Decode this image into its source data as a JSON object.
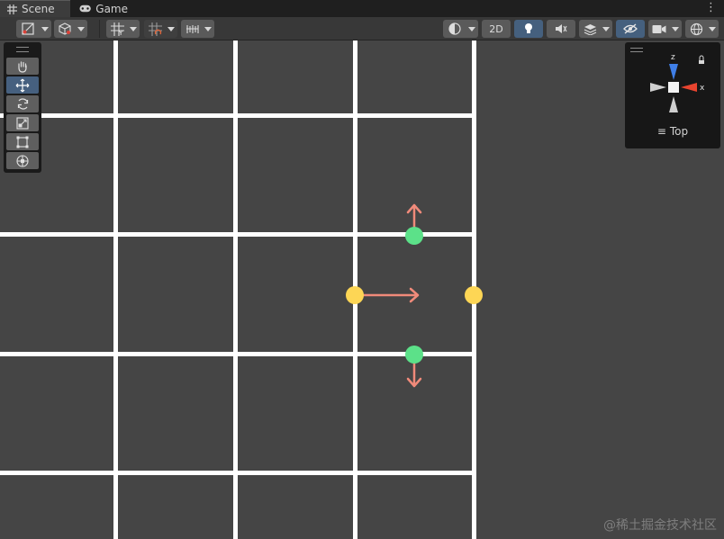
{
  "tabs": [
    {
      "label": "Scene",
      "icon": "grid-icon",
      "active": true
    },
    {
      "label": "Game",
      "icon": "gamepad-icon",
      "active": false
    }
  ],
  "tab_menu_glyph": "⋮",
  "toolbar": {
    "mode_2d_label": "2D"
  },
  "gizmo": {
    "view_label": "Top",
    "menu_glyph": "≡",
    "axis_z": "z",
    "axis_x": "x"
  },
  "colors": {
    "grid_line": "#ffffff",
    "scene_bg": "#454545",
    "handle_green": "#5ce189",
    "handle_yellow": "#fdd655",
    "arrow_salmon": "#f08a7a",
    "axis_blue": "#3f7fe8",
    "axis_red": "#e8442f"
  },
  "watermark": "@稀土掘金技术社区"
}
